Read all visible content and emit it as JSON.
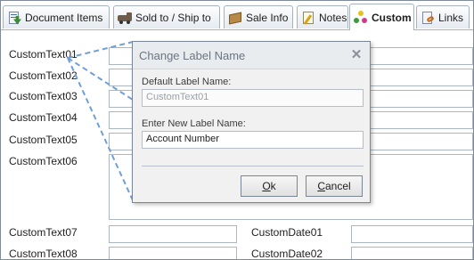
{
  "tabs": [
    {
      "label": "Document Items",
      "icon": "document-items-icon"
    },
    {
      "label": "Sold to / Ship to",
      "icon": "truck-icon"
    },
    {
      "label": "Sale Info",
      "icon": "box-icon"
    },
    {
      "label": "Notes",
      "icon": "notepad-icon"
    },
    {
      "label": "Custom",
      "icon": "palette-icon",
      "active": true
    },
    {
      "label": "Links",
      "icon": "link-document-icon"
    }
  ],
  "form": {
    "custom_text_labels": [
      "CustomText01",
      "CustomText02",
      "CustomText03",
      "CustomText04",
      "CustomText05",
      "CustomText06",
      "CustomText07",
      "CustomText08"
    ],
    "custom_date_labels": [
      "CustomDate01",
      "CustomDate02"
    ]
  },
  "dialog": {
    "title": "Change Label Name",
    "default_label_caption": "Default Label Name:",
    "default_label_value": "CustomText01",
    "new_label_caption": "Enter New Label Name:",
    "new_label_value": "Account Number",
    "ok_hotkey": "O",
    "ok_rest": "k",
    "cancel_hotkey": "C",
    "cancel_rest": "ancel"
  },
  "colors": {
    "connector": "#6f9fd8",
    "tab_border": "#a7b2c0",
    "dialog_title_text": "#6d7580"
  }
}
